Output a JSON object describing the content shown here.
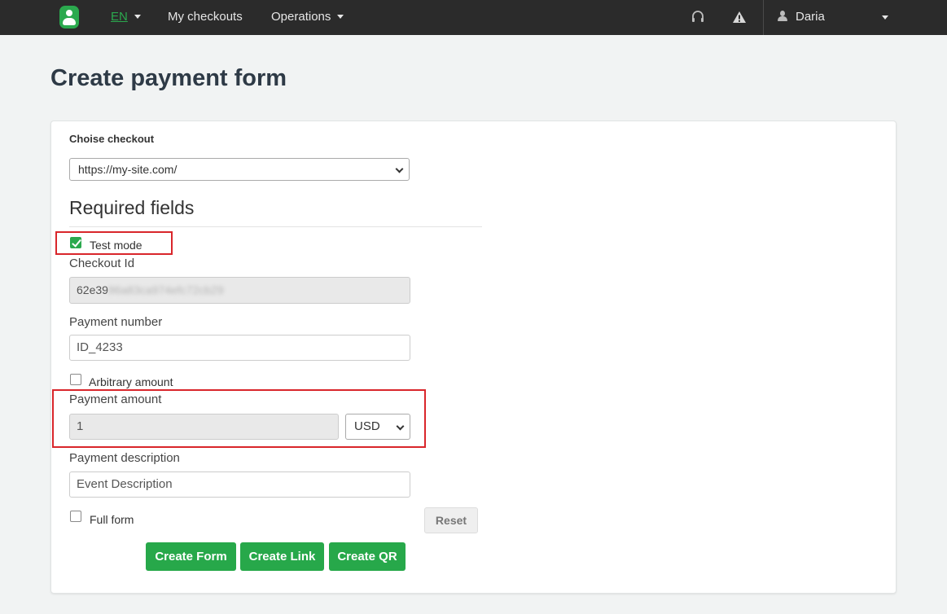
{
  "nav": {
    "lang": "EN",
    "my_checkouts": "My checkouts",
    "operations": "Operations",
    "user": "Daria"
  },
  "page": {
    "title": "Create payment form"
  },
  "form": {
    "checkout_label": "Choise checkout",
    "checkout_value": "https://my-site.com/",
    "section_title": "Required fields",
    "test_mode_label": "Test mode",
    "test_mode_checked": true,
    "checkout_id_label": "Checkout Id",
    "checkout_id_visible": "62e39",
    "checkout_id_blurred": "86a83ca974efc72cb29",
    "payment_number_label": "Payment number",
    "payment_number_value": "ID_4233",
    "arbitrary_amount_label": "Arbitrary amount",
    "arbitrary_amount_checked": false,
    "payment_amount_label": "Payment amount",
    "payment_amount_value": "1",
    "currency_value": "USD",
    "payment_description_label": "Payment description",
    "payment_description_value": "Event Description",
    "full_form_label": "Full form",
    "full_form_checked": false
  },
  "buttons": {
    "reset": "Reset",
    "create_form": "Create Form",
    "create_link": "Create Link",
    "create_qr": "Create QR"
  },
  "colors": {
    "brand": "#2ba94e",
    "navbar": "#2b2b2b",
    "highlight": "#d9262b"
  },
  "icons": {
    "logo": "user-badge-logo",
    "support": "headset-icon",
    "alert": "warning-triangle-icon",
    "user": "person-icon"
  }
}
